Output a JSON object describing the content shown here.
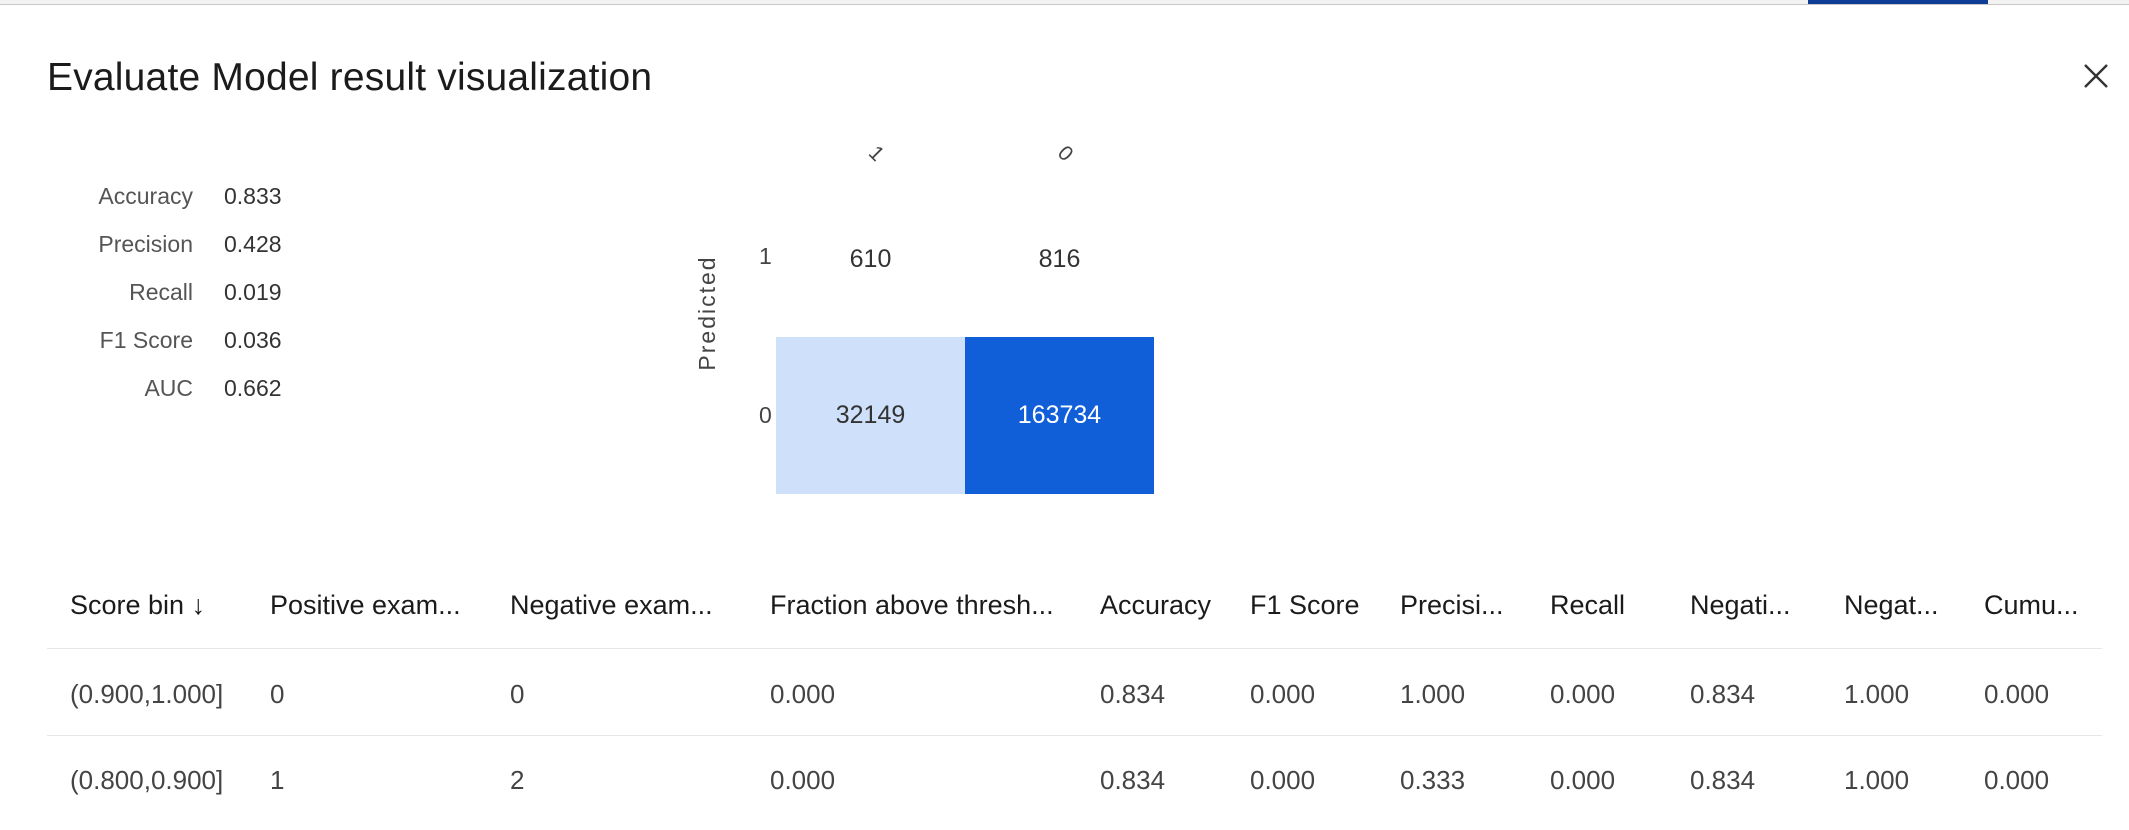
{
  "title": "Evaluate Model result visualization",
  "metrics": [
    {
      "label": "Accuracy",
      "value": "0.833"
    },
    {
      "label": "Precision",
      "value": "0.428"
    },
    {
      "label": "Recall",
      "value": "0.019"
    },
    {
      "label": "F1 Score",
      "value": "0.036"
    },
    {
      "label": "AUC",
      "value": "0.662"
    }
  ],
  "confusion_matrix": {
    "ylabel": "Predicted",
    "col_ticks": [
      "1",
      "0"
    ],
    "row_ticks": [
      "1",
      "0"
    ],
    "cells": [
      {
        "value": "610",
        "shade": "none"
      },
      {
        "value": "816",
        "shade": "none"
      },
      {
        "value": "32149",
        "shade": "light"
      },
      {
        "value": "163734",
        "shade": "dark"
      }
    ],
    "colors": {
      "light": "#cfe0fb",
      "dark": "#115ed9",
      "dark_text": "#ffffff",
      "light_text": "#333333"
    }
  },
  "table": {
    "columns": [
      "Score bin ↓",
      "Positive exam...",
      "Negative exam...",
      "Fraction above thresh...",
      "Accuracy",
      "F1 Score",
      "Precisi...",
      "Recall",
      "Negati...",
      "Negat...",
      "Cumu..."
    ],
    "rows": [
      [
        "(0.900,1.000]",
        "0",
        "0",
        "0.000",
        "0.834",
        "0.000",
        "1.000",
        "0.000",
        "0.834",
        "1.000",
        "0.000"
      ],
      [
        "(0.800,0.900]",
        "1",
        "2",
        "0.000",
        "0.834",
        "0.000",
        "0.333",
        "0.000",
        "0.834",
        "1.000",
        "0.000"
      ]
    ]
  }
}
